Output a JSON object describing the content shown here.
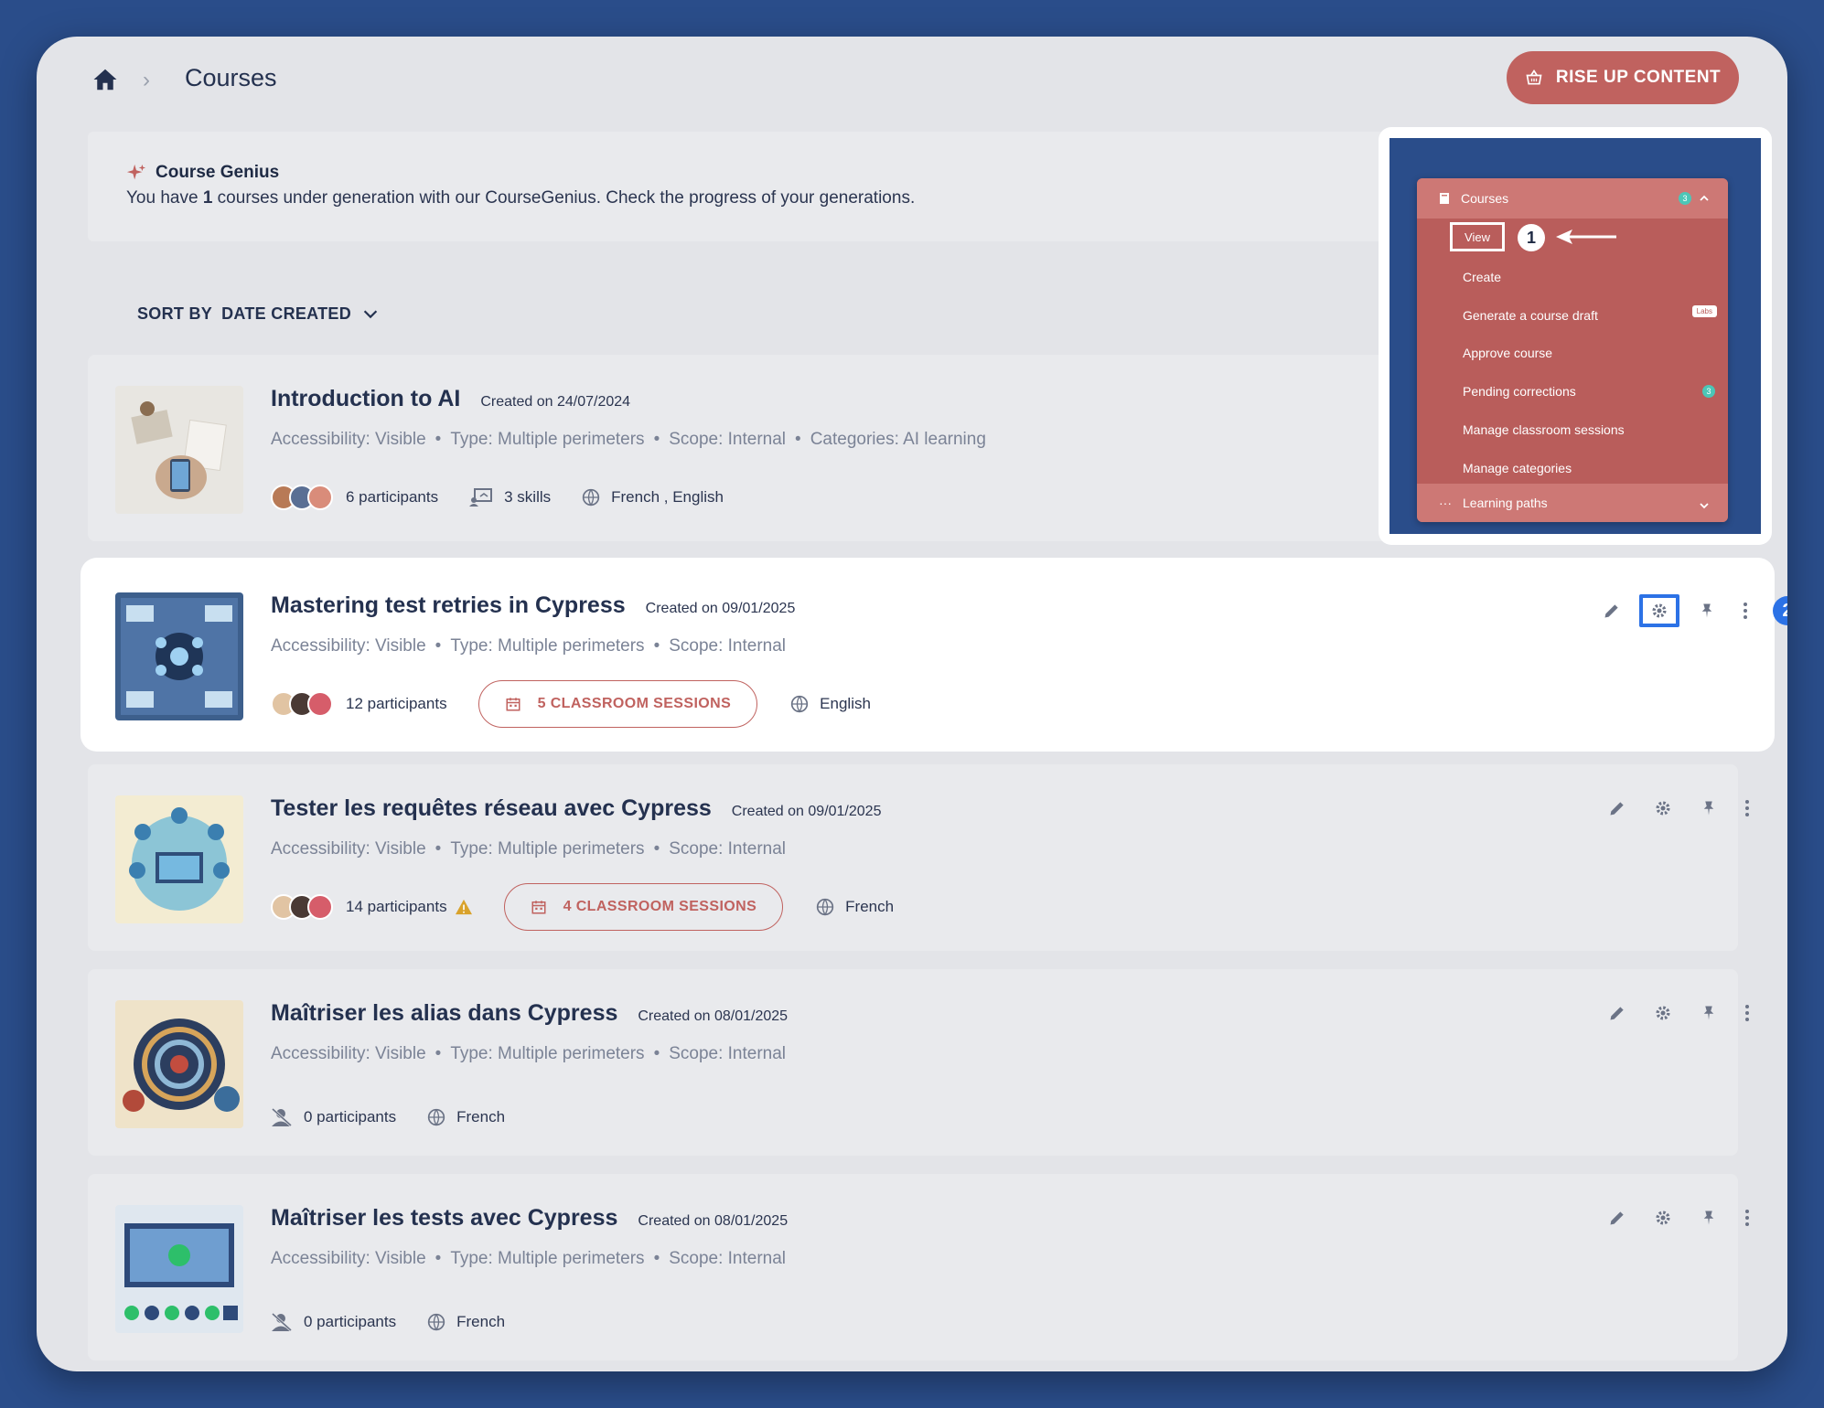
{
  "breadcrumb": {
    "title": "Courses"
  },
  "header": {
    "rise_button": "RISE UP CONTENT"
  },
  "genius": {
    "title": "Course Genius",
    "text_before": "You have ",
    "count": "1",
    "text_after": " courses under generation with our CourseGenius. Check the progress of your generations."
  },
  "sort": {
    "label": "SORT BY",
    "value": "DATE CREATED"
  },
  "courses": [
    {
      "title": "Introduction to AI",
      "date": "Created on 24/07/2024",
      "accessibility": "Accessibility: Visible",
      "type": "Type: Multiple perimeters",
      "scope": "Scope: Internal",
      "categories": "Categories: AI learning",
      "participants": "6 participants",
      "skills": "3 skills",
      "languages": "French , English"
    },
    {
      "title": "Mastering test retries in Cypress",
      "date": "Created on 09/01/2025",
      "accessibility": "Accessibility: Visible",
      "type": "Type: Multiple perimeters",
      "scope": "Scope: Internal",
      "participants": "12 participants",
      "sessions": "5 CLASSROOM SESSIONS",
      "languages": "English",
      "step": "2"
    },
    {
      "title": "Tester les requêtes réseau avec Cypress",
      "date": "Created on 09/01/2025",
      "accessibility": "Accessibility: Visible",
      "type": "Type: Multiple perimeters",
      "scope": "Scope: Internal",
      "participants": "14 participants",
      "sessions": "4 CLASSROOM SESSIONS",
      "languages": "French"
    },
    {
      "title": "Maîtriser les alias dans Cypress",
      "date": "Created on 08/01/2025",
      "accessibility": "Accessibility: Visible",
      "type": "Type: Multiple perimeters",
      "scope": "Scope: Internal",
      "participants": "0 participants",
      "languages": "French"
    },
    {
      "title": "Maîtriser les tests avec Cypress",
      "date": "Created on 08/01/2025",
      "accessibility": "Accessibility: Visible",
      "type": "Type: Multiple perimeters",
      "scope": "Scope: Internal",
      "participants": "0 participants",
      "languages": "French"
    }
  ],
  "menu": {
    "header": "Courses",
    "header_badge": "3",
    "view": "View",
    "step": "1",
    "items": [
      "Create",
      "Generate a course draft",
      "Approve course",
      "Pending corrections",
      "Manage classroom sessions",
      "Manage categories"
    ],
    "labs_badge": "Labs",
    "pending_badge": "3",
    "footer": "Learning paths"
  },
  "colors": {
    "accent": "#c0625f",
    "highlight": "#2c72e6",
    "background": "#2a4d8a"
  }
}
